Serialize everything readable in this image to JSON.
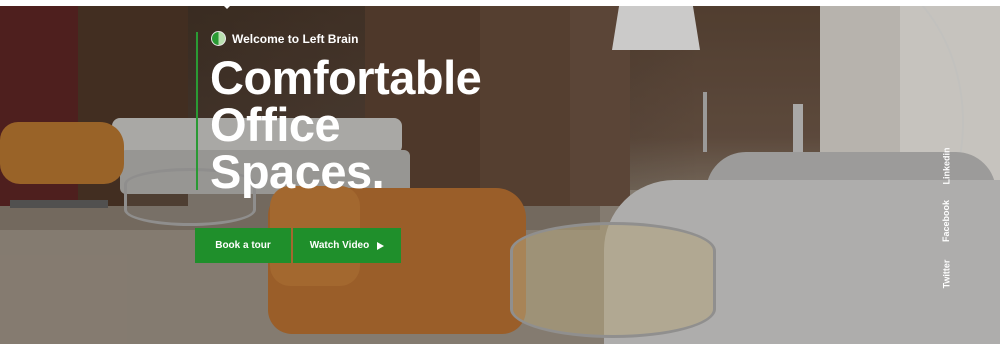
{
  "hero": {
    "welcome": "Welcome to Left Brain",
    "title_lines": [
      "Comfortable",
      "Office",
      "Spaces."
    ]
  },
  "buttons": {
    "tour_label": "Book a tour",
    "video_label": "Watch Video"
  },
  "social": {
    "linkedin": "Linkedin",
    "facebook": "Facebook",
    "twitter": "Twitter"
  },
  "colors": {
    "accent": "#1f8f2b"
  },
  "icons": {
    "welcome": "leaf-circle-icon",
    "play": "play-icon"
  }
}
